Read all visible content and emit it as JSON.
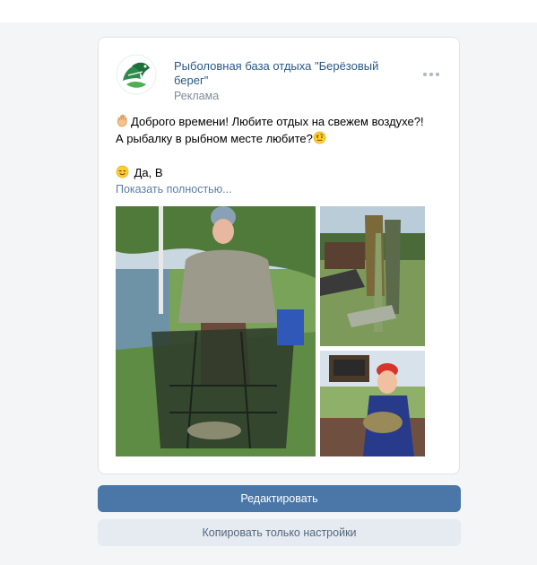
{
  "post": {
    "author": "Рыболовная база отдыха \"Берёзовый берег\"",
    "label": "Реклама",
    "text_lines": [
      "Доброго времени! Любите отдых на свежем воздухе?!",
      "А рыбалку в рыбном месте любите?",
      "",
      "Да, В"
    ],
    "show_more": "Показать полностью..."
  },
  "icons": {
    "menu": "more-dots-icon",
    "emoji_wave": "waving-hand-icon",
    "emoji_thinking": "face-with-raised-eyebrow-icon",
    "emoji_wink": "winking-face-icon"
  },
  "buttons": {
    "edit": "Редактировать",
    "copy_settings": "Копировать только настройки"
  },
  "colors": {
    "link": "#2a5885",
    "primary_button": "#4a76a8",
    "secondary_button": "#e5ebf1",
    "background": "#f4f5f7"
  }
}
